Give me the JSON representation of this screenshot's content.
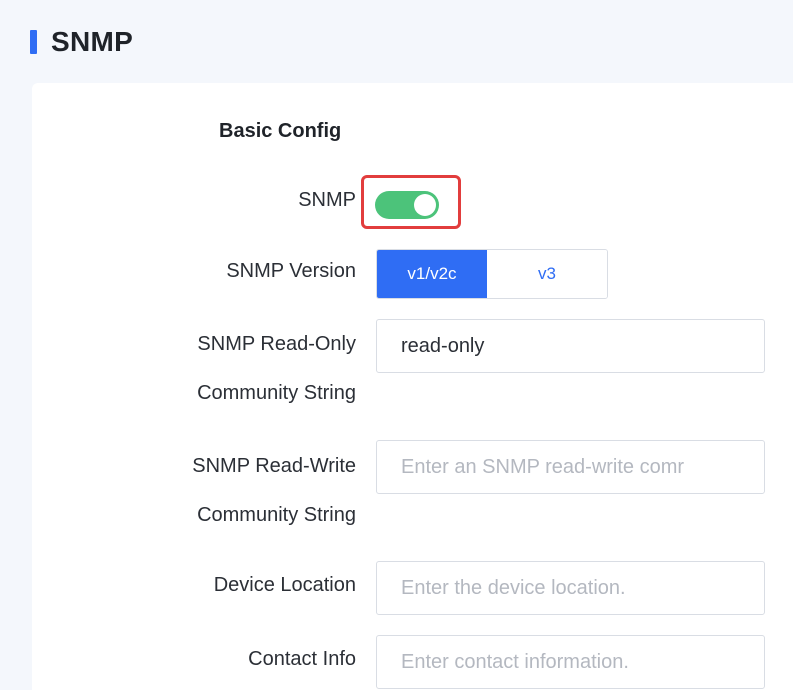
{
  "header": {
    "title": "SNMP"
  },
  "section": {
    "title": "Basic Config"
  },
  "fields": {
    "snmp_toggle": {
      "label": "SNMP",
      "enabled": true
    },
    "snmp_version": {
      "label": "SNMP Version",
      "options": [
        "v1/v2c",
        "v3"
      ],
      "selected": "v1/v2c"
    },
    "read_only_community": {
      "label_line1": "SNMP Read-Only",
      "label_line2": "Community String",
      "value": "read-only",
      "placeholder": ""
    },
    "read_write_community": {
      "label_line1": "SNMP Read-Write",
      "label_line2": "Community String",
      "value": "",
      "placeholder": "Enter an SNMP read-write comr"
    },
    "device_location": {
      "label": "Device Location",
      "value": "",
      "placeholder": "Enter the device location."
    },
    "contact_info": {
      "label": "Contact Info",
      "value": "",
      "placeholder": "Enter contact information."
    }
  },
  "colors": {
    "accent": "#2f6df4",
    "switch_on": "#4cc37a",
    "highlight": "#e23d3d",
    "background": "#f4f7fc"
  }
}
